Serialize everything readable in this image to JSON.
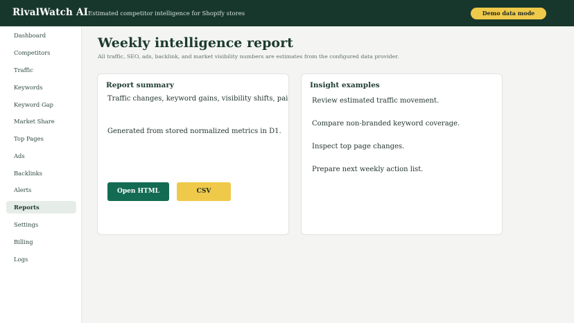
{
  "header": {
    "brand": "RivalWatch AI",
    "tagline": "Estimated competitor intelligence for Shopify stores",
    "demo_button": "Demo data mode"
  },
  "sidebar": {
    "items": [
      {
        "label": "Dashboard"
      },
      {
        "label": "Competitors"
      },
      {
        "label": "Traffic"
      },
      {
        "label": "Keywords"
      },
      {
        "label": "Keyword Gap"
      },
      {
        "label": "Market Share"
      },
      {
        "label": "Top Pages"
      },
      {
        "label": "Ads"
      },
      {
        "label": "Backlinks"
      },
      {
        "label": "Alerts"
      },
      {
        "label": "Reports",
        "active": true
      },
      {
        "label": "Settings"
      },
      {
        "label": "Billing"
      },
      {
        "label": "Logs"
      }
    ]
  },
  "main": {
    "title": "Weekly intelligence report",
    "subtitle": "All traffic, SEO, ads, backlink, and market visibility numbers are estimates from the configured data provider.",
    "report_summary": {
      "title": "Report summary",
      "line1": "Traffic changes, keyword gains, visibility shifts, paid ads movement, and new backlinks.",
      "line2": "Generated from stored normalized metrics in D1.",
      "open_html": "Open HTML",
      "csv": "CSV"
    },
    "insights": {
      "title": "Insight examples",
      "items": [
        "Review estimated traffic movement.",
        "Compare non-branded keyword coverage.",
        "Inspect top page changes.",
        "Prepare next weekly action list."
      ]
    }
  },
  "colors": {
    "header_bg": "#18372c",
    "accent_yellow": "#efc94a",
    "primary_green": "#146b53",
    "page_bg": "#f4f5f2"
  }
}
